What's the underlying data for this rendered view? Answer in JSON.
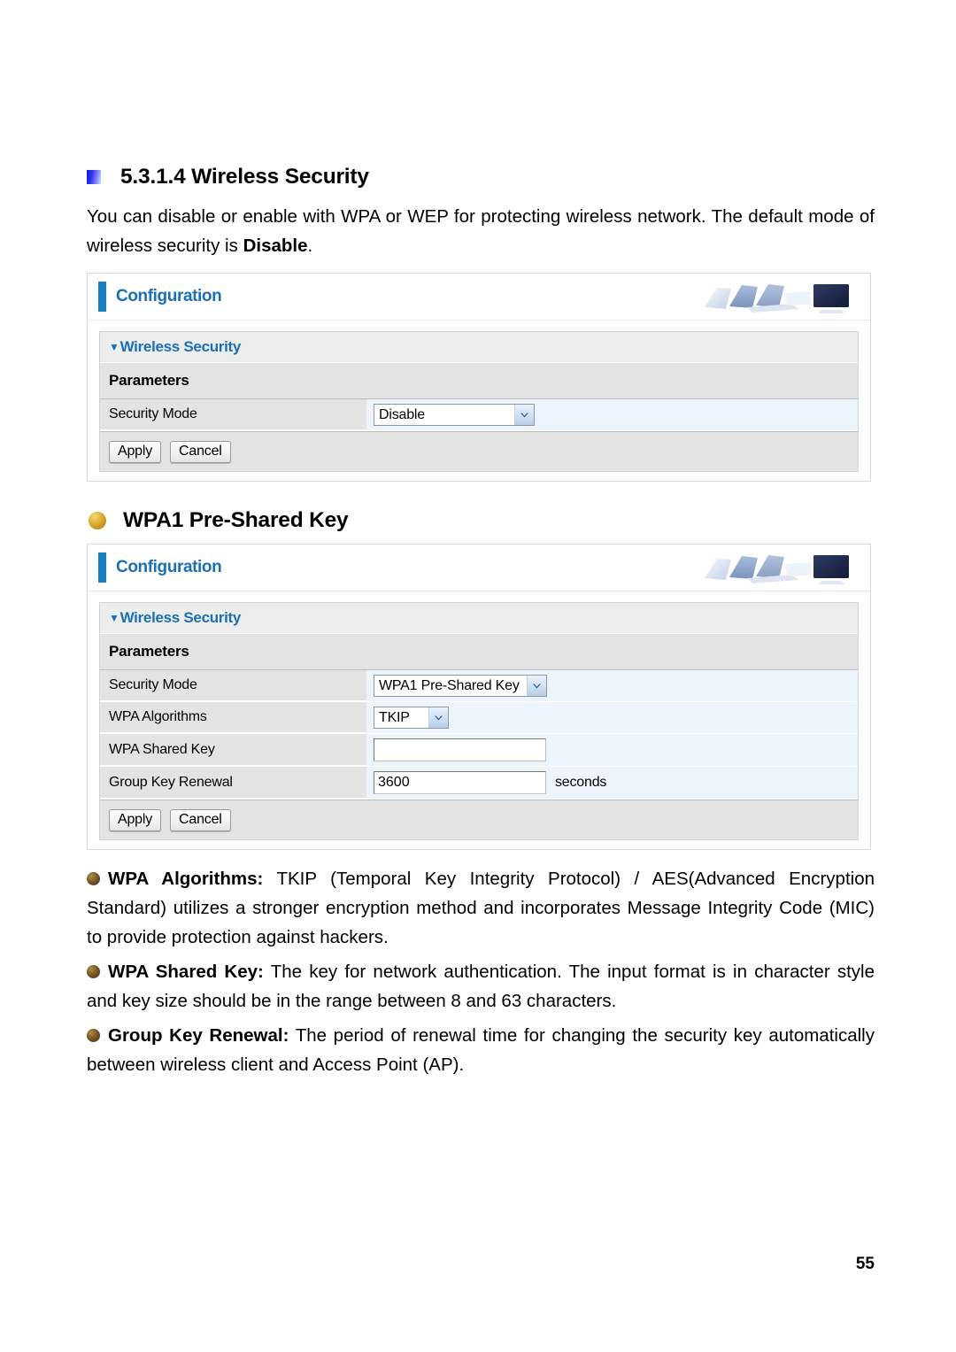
{
  "document": {
    "page_number": "55"
  },
  "section": {
    "heading": "5.3.1.4 Wireless Security",
    "intro_html_part1": "You can disable or enable with WPA or WEP for protecting wireless network. The default mode of wireless security is ",
    "intro_bold": "Disable",
    "intro_end": "."
  },
  "panel1": {
    "title": "Configuration",
    "section_title": "Wireless Security",
    "caret": "▼",
    "params_label": "Parameters",
    "rows": [
      {
        "label": "Security Mode",
        "value": "Disable",
        "control": "select"
      }
    ],
    "apply_label": "Apply",
    "cancel_label": "Cancel"
  },
  "wpa_heading": "WPA1 Pre-Shared Key",
  "panel2": {
    "title": "Configuration",
    "section_title": "Wireless Security",
    "caret": "▼",
    "params_label": "Parameters",
    "rows": [
      {
        "label": "Security Mode",
        "value": "WPA1 Pre-Shared Key",
        "control": "select"
      },
      {
        "label": "WPA Algorithms",
        "value": "TKIP",
        "control": "select"
      },
      {
        "label": "WPA Shared Key",
        "value": "",
        "control": "text"
      },
      {
        "label": "Group Key Renewal",
        "value": "3600",
        "control": "text",
        "unit": "seconds"
      }
    ],
    "apply_label": "Apply",
    "cancel_label": "Cancel"
  },
  "descriptions": [
    {
      "term": "WPA Algorithms:",
      "text": " TKIP (Temporal Key Integrity Protocol) / AES(Advanced Encryption Standard) utilizes a stronger encryption method and incorporates Message Integrity Code (MIC) to provide protection against hackers."
    },
    {
      "term": "WPA Shared Key:",
      "text": " The key for network authentication. The input format is in character style and key size should be in the range between 8 and 63 characters."
    },
    {
      "term": "Group Key Renewal:",
      "text": " The period of renewal time for changing the security key automatically between wireless client and Access Point (AP)."
    }
  ],
  "colors": {
    "panel_title_blue": "#1b6fb5",
    "tab_blue": "#1a7fc1",
    "row_gray": "#e3e3e3",
    "row_value_blue": "#eef4fc",
    "gold_bullet": "#dcab2e"
  }
}
